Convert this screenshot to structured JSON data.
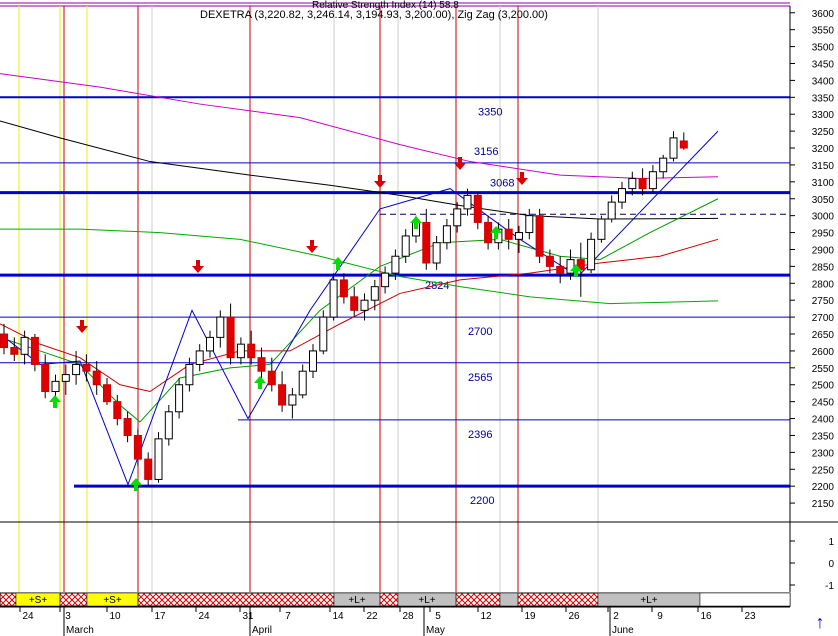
{
  "header": {
    "top_title": "Relative Strength Index (14) 58.8",
    "title": "DEXETRA (3,220.82, 3,246.14, 3,194.93, 3,200.00), Zig Zag (3,200.00)"
  },
  "colors": {
    "up_candle": "#ffffff",
    "down_candle": "#e00000",
    "hline": "#0000cc",
    "ma_fast": "#0000cc",
    "ma_green": "#00aa00",
    "ma_red": "#cc0000",
    "ma_magenta": "#cc00cc",
    "ma_black": "#000000",
    "signal_up": "#00dd00",
    "signal_down": "#dd0000"
  },
  "chart_data": {
    "type": "candlestick",
    "symbol": "DEXETRA",
    "last": {
      "open": 3220.82,
      "high": 3246.14,
      "low": 3194.93,
      "close": 3200.0
    },
    "ylim": [
      2100,
      3620
    ],
    "yticks": [
      2150,
      2200,
      2250,
      2300,
      2350,
      2400,
      2450,
      2500,
      2550,
      2600,
      2650,
      2700,
      2750,
      2800,
      2850,
      2900,
      2950,
      3000,
      3050,
      3100,
      3150,
      3200,
      3250,
      3300,
      3350,
      3400,
      3450,
      3500,
      3550,
      3600
    ],
    "lower_panel_ticks": [
      "1",
      "0",
      "-1"
    ],
    "horizontal_levels": [
      {
        "value": 3350,
        "label": "3350"
      },
      {
        "value": 3156,
        "label": "3156"
      },
      {
        "value": 3068,
        "label": "3068"
      },
      {
        "value": 2824,
        "label": "2824"
      },
      {
        "value": 2700,
        "label": "2700"
      },
      {
        "value": 2565,
        "label": "2565"
      },
      {
        "value": 2396,
        "label": "2396"
      },
      {
        "value": 2200,
        "label": "2200"
      }
    ],
    "x_day_labels": [
      "24",
      "3",
      "10",
      "17",
      "24",
      "31",
      "7",
      "14",
      "22",
      "28",
      "5",
      "12",
      "19",
      "26",
      "2",
      "9",
      "16",
      "23"
    ],
    "x_month_labels": [
      "March",
      "April",
      "May",
      "June"
    ],
    "signal_bar": [
      "+S+",
      "+S+",
      "+L+",
      "+L+",
      "+L+"
    ],
    "candles": [
      [
        2650,
        2680,
        2590,
        2610
      ],
      [
        2610,
        2640,
        2570,
        2590
      ],
      [
        2590,
        2660,
        2560,
        2640
      ],
      [
        2640,
        2650,
        2540,
        2560
      ],
      [
        2560,
        2590,
        2460,
        2480
      ],
      [
        2480,
        2530,
        2450,
        2510
      ],
      [
        2510,
        2560,
        2470,
        2530
      ],
      [
        2530,
        2600,
        2500,
        2560
      ],
      [
        2560,
        2590,
        2510,
        2540
      ],
      [
        2540,
        2570,
        2470,
        2500
      ],
      [
        2500,
        2520,
        2440,
        2450
      ],
      [
        2450,
        2470,
        2380,
        2400
      ],
      [
        2400,
        2420,
        2330,
        2350
      ],
      [
        2350,
        2370,
        2260,
        2280
      ],
      [
        2280,
        2300,
        2200,
        2220
      ],
      [
        2220,
        2360,
        2210,
        2340
      ],
      [
        2340,
        2440,
        2320,
        2420
      ],
      [
        2420,
        2520,
        2400,
        2500
      ],
      [
        2500,
        2580,
        2480,
        2560
      ],
      [
        2560,
        2620,
        2540,
        2600
      ],
      [
        2600,
        2660,
        2580,
        2640
      ],
      [
        2640,
        2720,
        2610,
        2700
      ],
      [
        2700,
        2740,
        2560,
        2580
      ],
      [
        2580,
        2640,
        2560,
        2620
      ],
      [
        2620,
        2660,
        2560,
        2580
      ],
      [
        2580,
        2610,
        2520,
        2540
      ],
      [
        2540,
        2580,
        2480,
        2500
      ],
      [
        2500,
        2540,
        2420,
        2440
      ],
      [
        2440,
        2490,
        2400,
        2470
      ],
      [
        2470,
        2560,
        2460,
        2540
      ],
      [
        2540,
        2620,
        2520,
        2600
      ],
      [
        2600,
        2720,
        2590,
        2700
      ],
      [
        2700,
        2830,
        2690,
        2810
      ],
      [
        2810,
        2830,
        2740,
        2760
      ],
      [
        2760,
        2790,
        2700,
        2720
      ],
      [
        2720,
        2770,
        2690,
        2750
      ],
      [
        2750,
        2810,
        2720,
        2790
      ],
      [
        2790,
        2850,
        2770,
        2830
      ],
      [
        2830,
        2900,
        2810,
        2880
      ],
      [
        2880,
        2960,
        2860,
        2940
      ],
      [
        2940,
        3000,
        2920,
        2980
      ],
      [
        2980,
        3020,
        2840,
        2860
      ],
      [
        2860,
        2940,
        2840,
        2920
      ],
      [
        2920,
        2990,
        2900,
        2970
      ],
      [
        2970,
        3040,
        2950,
        3020
      ],
      [
        3020,
        3080,
        3000,
        3060
      ],
      [
        3060,
        3070,
        2960,
        2980
      ],
      [
        2980,
        3000,
        2900,
        2920
      ],
      [
        2920,
        2980,
        2900,
        2960
      ],
      [
        2960,
        2990,
        2900,
        2930
      ],
      [
        2930,
        2970,
        2890,
        2950
      ],
      [
        2950,
        3020,
        2930,
        3000
      ],
      [
        3000,
        3020,
        2860,
        2880
      ],
      [
        2880,
        2900,
        2830,
        2850
      ],
      [
        2850,
        2880,
        2800,
        2830
      ],
      [
        2830,
        2900,
        2810,
        2870
      ],
      [
        2870,
        2920,
        2760,
        2840
      ],
      [
        2840,
        2950,
        2830,
        2930
      ],
      [
        2930,
        3000,
        2920,
        2990
      ],
      [
        2990,
        3060,
        2980,
        3040
      ],
      [
        3040,
        3100,
        3020,
        3080
      ],
      [
        3080,
        3130,
        3060,
        3110
      ],
      [
        3110,
        3140,
        3060,
        3080
      ],
      [
        3080,
        3150,
        3070,
        3130
      ],
      [
        3130,
        3180,
        3110,
        3170
      ],
      [
        3170,
        3250,
        3160,
        3230
      ],
      [
        3220.82,
        3246.14,
        3194.93,
        3200.0
      ]
    ]
  }
}
